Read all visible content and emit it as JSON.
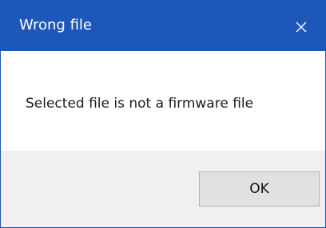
{
  "dialog": {
    "title": "Wrong file",
    "close_icon": "close-icon",
    "message": "Selected file is not a firmware file",
    "ok_label": "OK"
  },
  "colors": {
    "titlebar": "#1c57b9",
    "title_text": "#ffffff",
    "footer": "#f0f0f0",
    "button": "#e1e1e1",
    "button_border": "#b3b3b3"
  }
}
